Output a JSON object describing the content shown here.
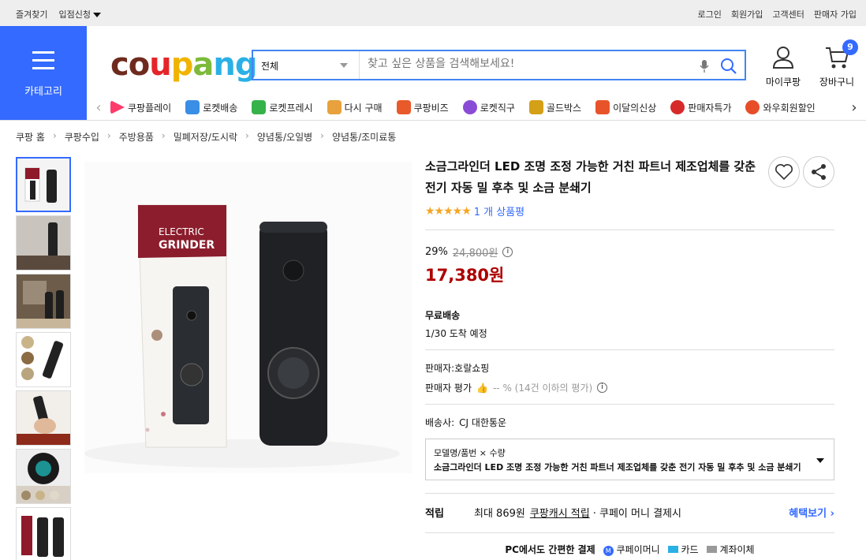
{
  "topbar": {
    "bookmark": "즐겨찾기",
    "seller_apply": "입점신청",
    "login": "로그인",
    "signup": "회원가입",
    "support": "고객센터",
    "seller_join": "판매자 가입"
  },
  "category_button": {
    "label": "카테고리"
  },
  "logo": {
    "letters": [
      "c",
      "o",
      "u",
      "p",
      "a",
      "n",
      "g"
    ]
  },
  "search": {
    "category": "전체",
    "placeholder": "찾고 싶은 상품을 검색해보세요!"
  },
  "header_icons": {
    "mypage": "마이쿠팡",
    "cart": "장바구니",
    "cart_count": "9"
  },
  "nav": {
    "items": [
      {
        "label": "쿠팡플레이",
        "icon": "play-icon",
        "color": "#ff3b6b"
      },
      {
        "label": "로켓배송",
        "icon": "rocket-icon",
        "color": "#3a8ee6"
      },
      {
        "label": "로켓프레시",
        "icon": "rocket-fresh-icon",
        "color": "#35b34a"
      },
      {
        "label": "다시 구매",
        "icon": "rebuy-icon",
        "color": "#e8a13c"
      },
      {
        "label": "쿠팡비즈",
        "icon": "biz-icon",
        "color": "#e85a2a"
      },
      {
        "label": "로켓직구",
        "icon": "global-icon",
        "color": "#8a4cd6"
      },
      {
        "label": "골드박스",
        "icon": "gold-box-icon",
        "color": "#d4a017"
      },
      {
        "label": "이달의신상",
        "icon": "new-icon",
        "color": "#e8542a"
      },
      {
        "label": "판매자특가",
        "icon": "sale-icon",
        "color": "#d62a2a"
      },
      {
        "label": "와우회원할인",
        "icon": "wow-icon",
        "color": "#e84d2a"
      }
    ]
  },
  "breadcrumbs": [
    "쿠팡 홈",
    "쿠팡수입",
    "주방용품",
    "밀폐저장/도시락",
    "양념통/오일병",
    "양념통/조미료통"
  ],
  "product": {
    "title": "소금그라인더 LED 조명 조정 가능한 거친 파트너 제조업체를 갖춘 전기 자동 밀 후추 및 소금 분쇄기",
    "rating_text": "1 개 상품평",
    "discount": "29%",
    "original_price": "24,800원",
    "price": "17,380원",
    "shipping_label": "무료배송",
    "arrival": "1/30 도착 예정",
    "seller": "판매자:호랄쇼핑",
    "seller_rating_label": "판매자 평가",
    "seller_rating_value": "-- % (14건 이하의 평가)",
    "carrier_label": "배송사:",
    "carrier": "CJ 대한통운",
    "option_label": "모델명/품번 × 수량",
    "option_value": "소금그라인더 LED 조명 조정 가능한 거친 파트너 제조업체를 갖춘 전기 자동 밀 후추 및 소금 분쇄기",
    "reward_label": "적립",
    "reward_text1": "최대 869원",
    "reward_link": "쿠팡캐시 적립",
    "reward_text2": "· 쿠페이 머니 결제시",
    "reward_more": "혜택보기 ›",
    "pay_title": "PC에서도 간편한 결제",
    "pay_money": "쿠페이머니",
    "pay_card": "카드",
    "pay_bank": "계좌이체"
  },
  "image": {
    "box_title_1": "ELECTRIC",
    "box_title_2": "GRINDER"
  },
  "colors": {
    "accent": "#346aff",
    "price": "#ae0000"
  }
}
